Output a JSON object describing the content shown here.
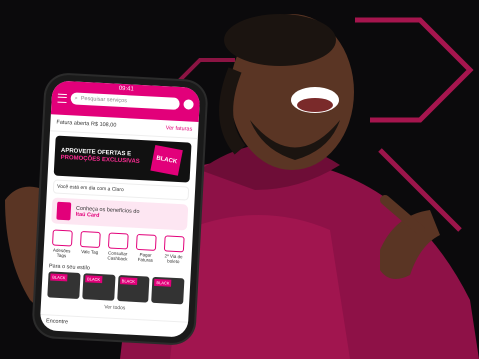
{
  "phone": {
    "status_time": "09:41",
    "search_placeholder": "Pesquisar serviços",
    "invoice_label": "Fatura aberta",
    "invoice_value": "R$ 108,00",
    "invoice_link": "Ver faturas",
    "banner_line1": "APROVEITE OFERTAS E",
    "banner_line2": "PROMOÇÕES EXCLUSIVAS",
    "banner_tag": "BLACK",
    "notice": "Você está em dia com a Claro",
    "benefit_line1": "Conheça os benefícios do",
    "benefit_line2": "Itaú Card",
    "quick_actions": [
      {
        "label": "Adesões Tags"
      },
      {
        "label": "Vale Tag"
      },
      {
        "label": "Consultar Cashback"
      },
      {
        "label": "Pagar Faturas"
      },
      {
        "label": "2ª Via de boleto"
      }
    ],
    "section_title": "Para o seu estilo",
    "more_label": "Ver todos",
    "footer_label": "Encontre"
  },
  "colors": {
    "accent": "#e2007a",
    "background": "#0b0a0c"
  }
}
